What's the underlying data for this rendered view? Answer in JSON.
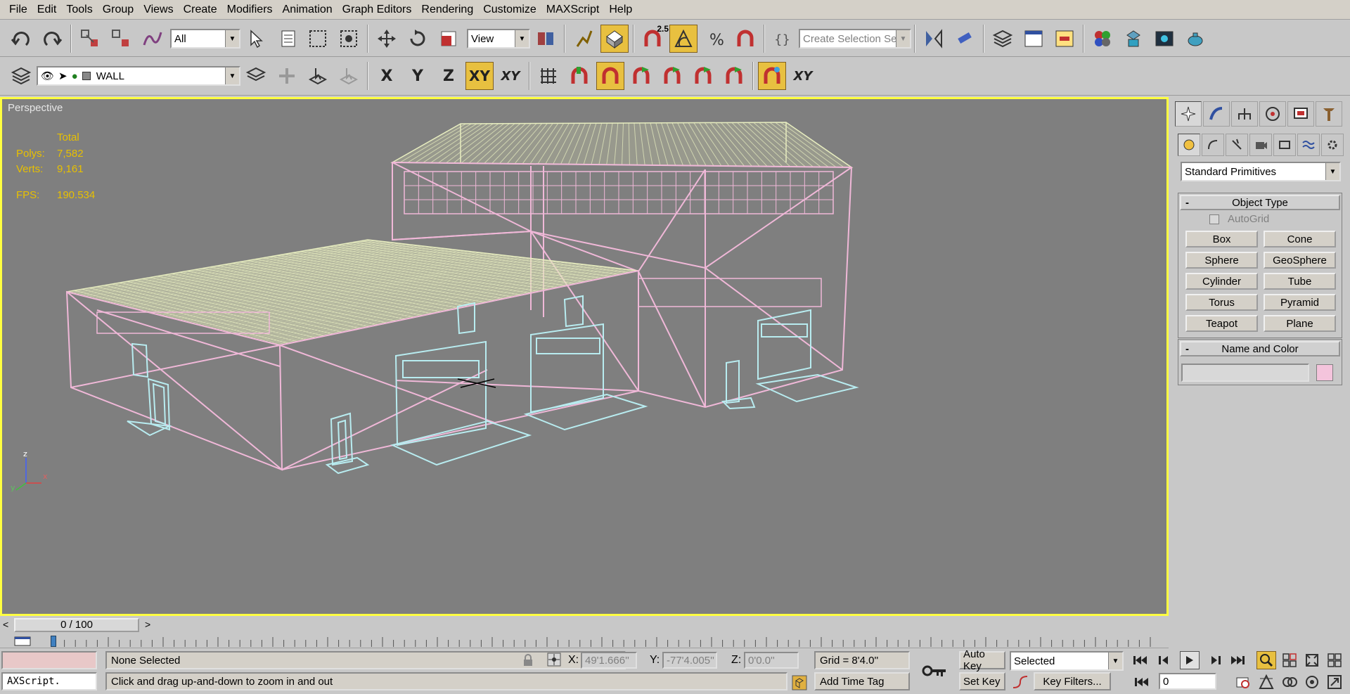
{
  "menu": [
    "File",
    "Edit",
    "Tools",
    "Group",
    "Views",
    "Create",
    "Modifiers",
    "Animation",
    "Graph Editors",
    "Rendering",
    "Customize",
    "MAXScript",
    "Help"
  ],
  "toolbar": {
    "selection_filter": "All",
    "reference_coord": "View",
    "snap_value": "2.5",
    "named_selection_placeholder": "Create Selection Set",
    "layer_name": "WALL",
    "axis_x": "X",
    "axis_y": "Y",
    "axis_z": "Z",
    "axis_xy": "XY",
    "axis_xy2": "XY",
    "axis_xy3": "XY"
  },
  "viewport": {
    "label": "Perspective",
    "stats": {
      "header": "Total",
      "polys_label": "Polys:",
      "polys": "7,582",
      "verts_label": "Verts:",
      "verts": "9,161",
      "fps_label": "FPS:",
      "fps": "190.534"
    },
    "axis_x": "x",
    "axis_y": "y",
    "axis_z": "z"
  },
  "command_panel": {
    "category": "Standard Primitives",
    "object_type_title": "Object Type",
    "autogrid_label": "AutoGrid",
    "primitives": [
      "Box",
      "Cone",
      "Sphere",
      "GeoSphere",
      "Cylinder",
      "Tube",
      "Torus",
      "Pyramid",
      "Teapot",
      "Plane"
    ],
    "name_color_title": "Name and Color",
    "name_value": "",
    "object_color": "#f4c4dc"
  },
  "timeline": {
    "frame_display": "0 / 100",
    "prev_arrow": "<",
    "next_arrow": ">"
  },
  "status": {
    "maxscript_text": "AXScript.",
    "selection": "None Selected",
    "prompt": "Click and drag up-and-down to zoom in and out",
    "x_label": "X:",
    "x_value": "49'1.666''",
    "y_label": "Y:",
    "y_value": "-77'4.005''",
    "z_label": "Z:",
    "z_value": "0'0.0''",
    "grid": "Grid = 8'4.0''",
    "add_time_tag": "Add Time Tag",
    "auto_key": "Auto Key",
    "set_key": "Set Key",
    "key_mode": "Selected",
    "key_filters": "Key Filters...",
    "current_frame": "0"
  },
  "colors": {
    "viewport_bg": "#7f7f7f",
    "active_border": "#ffff40",
    "stats_text": "#e8c000",
    "roof": "#e8eec0",
    "walls": "#f0b8d8",
    "doors": "#b8ecf0"
  }
}
